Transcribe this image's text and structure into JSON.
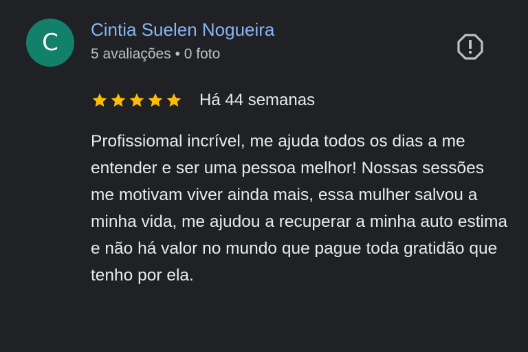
{
  "reviewer": {
    "avatar_letter": "C",
    "avatar_color": "#12806a",
    "name": "Cintia Suelen Nogueira",
    "name_color": "#8ab4f8",
    "meta": "5 avaliações • 0 foto"
  },
  "report_icon": "report-flag-icon",
  "rating": {
    "stars": 5,
    "max": 5,
    "star_color": "#fbbc04",
    "time": "Há 44 semanas"
  },
  "review_text": "Profissiomal incrível, me ajuda todos os dias a me entender e ser uma pessoa melhor! Nossas sessões me motivam viver ainda mais, essa mulher salvou a minha vida, me ajudou a recuperar a minha auto estima e não há valor no mundo que pague toda gratidão que tenho por ela."
}
